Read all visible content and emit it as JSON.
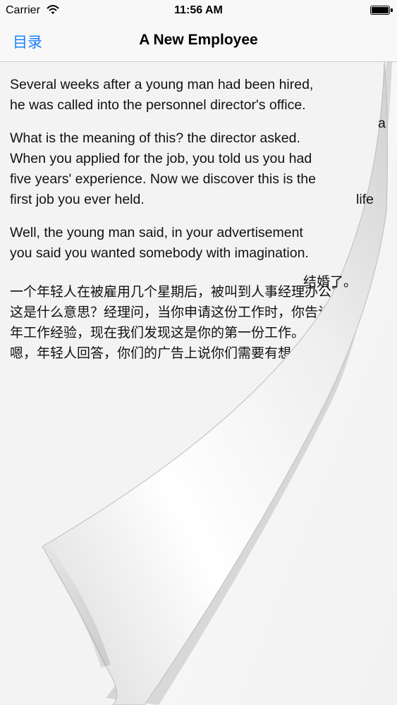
{
  "status_bar": {
    "carrier": "Carrier",
    "time": "11:56 AM"
  },
  "nav": {
    "back_label": "目录",
    "title": "A New Employee"
  },
  "story": {
    "en_p1": "Several weeks after a young man had been hired,\nhe was called into the personnel director's office.",
    "en_p2": "What is the meaning of this? the director asked.\nWhen you applied for the job, you told us you had\nfive years' experience. Now we discover this is the\nfirst job you ever held.",
    "en_p3": "Well, the young man said, in your advertisement\nyou said you wanted somebody with imagination.",
    "zh": "一个年轻人在被雇用几个星期后，被叫到人事经理办公室。\n这是什么意思？经理问，当你申请这份工作时，你告诉我们有五年工作经验，现在我们发现这是你的第一份工作。\n嗯，年轻人回答，你们的广告上说你们需要有想象力的人嘛。"
  },
  "underlying_page": {
    "peek_a": "a",
    "peek_life": "life",
    "peek_zh": "结婚了。"
  }
}
